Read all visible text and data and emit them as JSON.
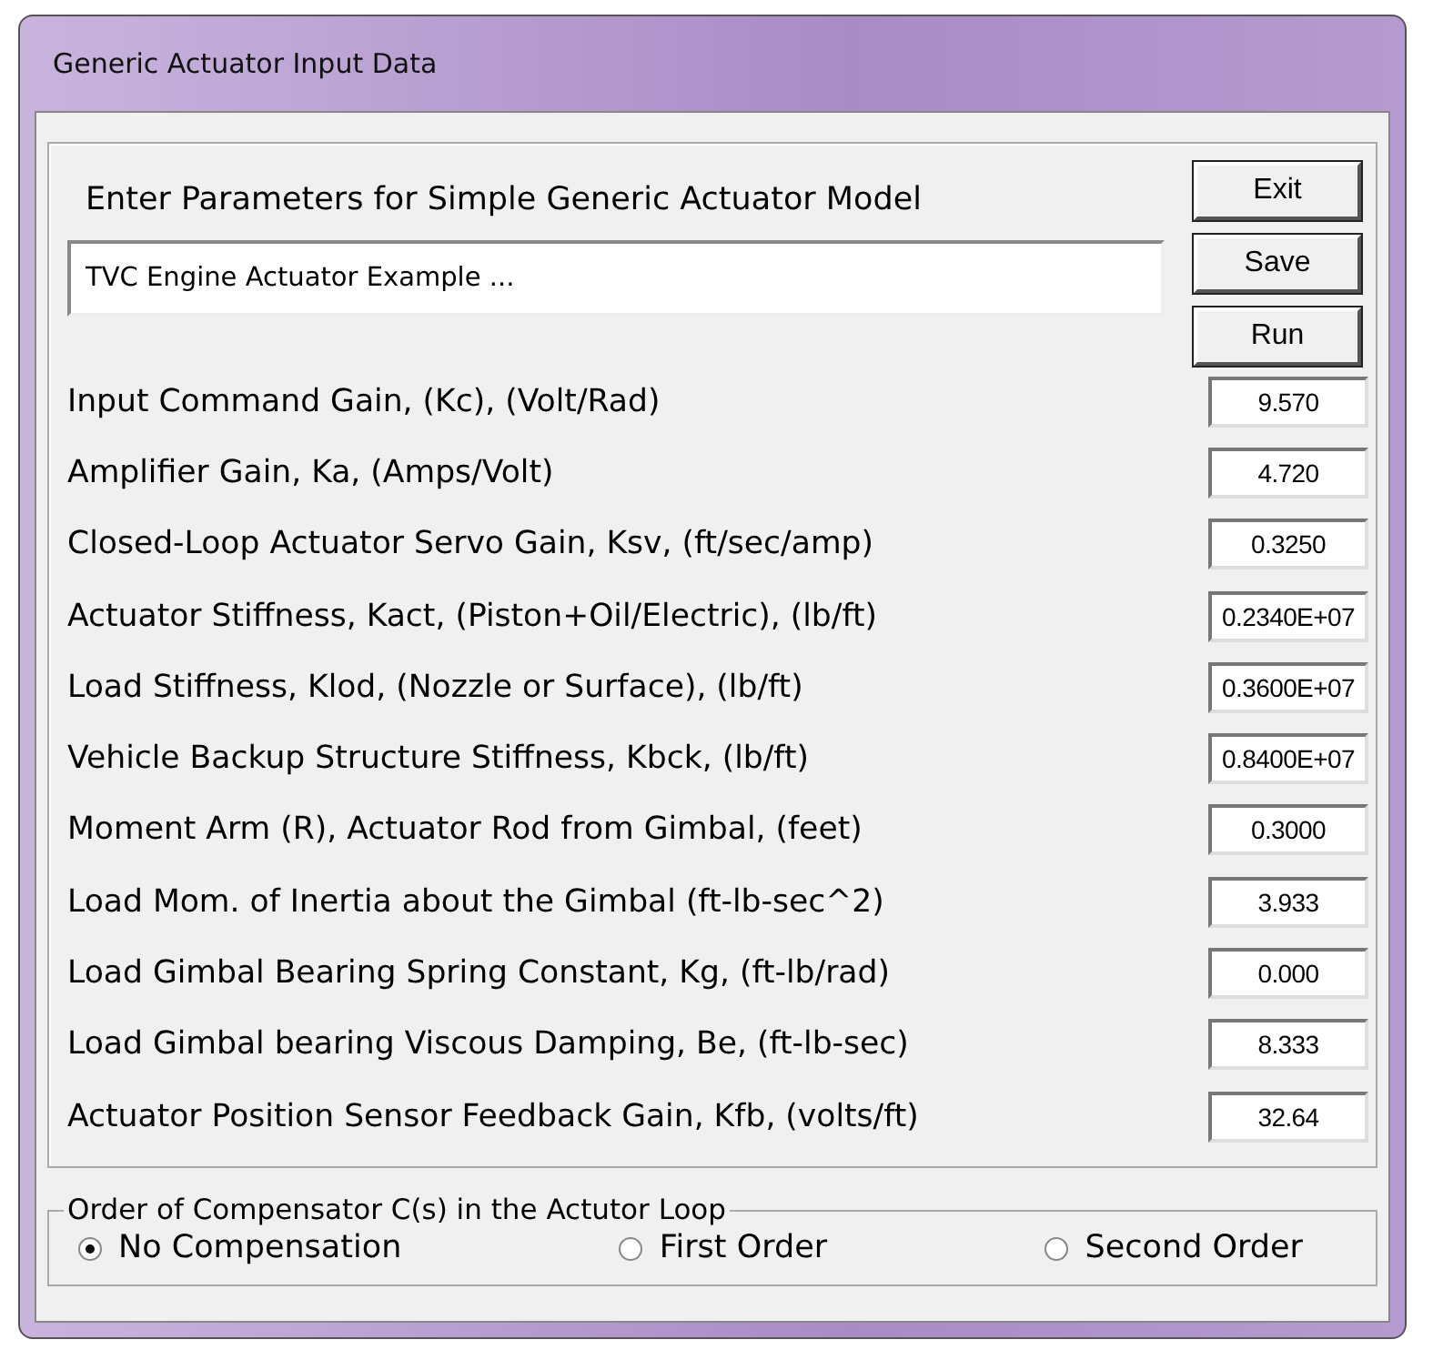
{
  "window": {
    "title": "Generic Actuator Input Data"
  },
  "heading": "Enter Parameters for Simple Generic Actuator Model",
  "description": {
    "value": "TVC Engine Actuator Example ..."
  },
  "buttons": [
    "Exit",
    "Save",
    "Run"
  ],
  "parameters": [
    {
      "label": "Input Command Gain, (Kc),  (Volt/Rad)",
      "value": "9.570"
    },
    {
      "label": "Amplifier Gain, Ka,  (Amps/Volt)",
      "value": "4.720"
    },
    {
      "label": "Closed-Loop Actuator Servo Gain, Ksv, (ft/sec/amp)",
      "value": "0.3250"
    },
    {
      "label": "Actuator Stiffness, Kact, (Piston+Oil/Electric), (lb/ft)",
      "value": "0.2340E+07"
    },
    {
      "label": "Load Stiffness, Klod, (Nozzle or Surface), (lb/ft)",
      "value": "0.3600E+07"
    },
    {
      "label": "Vehicle Backup Structure Stiffness, Kbck, (lb/ft)",
      "value": "0.8400E+07"
    },
    {
      "label": "Moment Arm (R), Actuator Rod from Gimbal, (feet)",
      "value": "0.3000"
    },
    {
      "label": "Load Mom. of Inertia about the Gimbal (ft-lb-sec^2)",
      "value": "3.933"
    },
    {
      "label": "Load Gimbal Bearing Spring Constant, Kg, (ft-lb/rad)",
      "value": "0.000"
    },
    {
      "label": "Load Gimbal bearing Viscous Damping, Be, (ft-lb-sec)",
      "value": "8.333"
    },
    {
      "label": "Actuator Position Sensor Feedback Gain, Kfb, (volts/ft)",
      "value": "32.64"
    }
  ],
  "compensator": {
    "title": "Order of Compensator C(s) in the Actutor Loop",
    "options": [
      {
        "label": "No Compensation",
        "selected": true
      },
      {
        "label": "First Order",
        "selected": false
      },
      {
        "label": "Second Order",
        "selected": false
      }
    ]
  }
}
